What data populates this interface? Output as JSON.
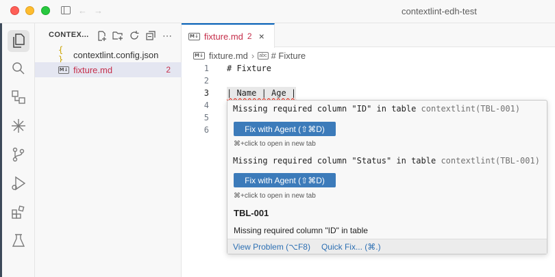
{
  "window": {
    "title": "contextlint-edh-test"
  },
  "sidebar": {
    "header": "CONTEX...",
    "files": [
      {
        "name": "contextlint.config.json",
        "type": "json",
        "icon": "{ }"
      },
      {
        "name": "fixture.md",
        "type": "markdown",
        "icon": "M↓",
        "errors": "2"
      }
    ]
  },
  "tab": {
    "name": "fixture.md",
    "count": "2",
    "icon": "M↓"
  },
  "breadcrumb": {
    "file": "fixture.md",
    "symbol": "# Fixture"
  },
  "editor": {
    "lines": [
      {
        "num": "1",
        "text": "# Fixture"
      },
      {
        "num": "2",
        "text": ""
      },
      {
        "num": "3",
        "text": "| Name | Age |"
      },
      {
        "num": "4",
        "text": ""
      },
      {
        "num": "5",
        "text": ""
      },
      {
        "num": "6",
        "text": ""
      }
    ]
  },
  "hover": {
    "problems": [
      {
        "message": "Missing required column \"ID\" in table",
        "source": "contextlint(TBL-001)",
        "button": "Fix with Agent (⇧⌘D)",
        "hint": "⌘+click to open in new tab"
      },
      {
        "message": "Missing required column \"Status\" in table",
        "source": "contextlint(TBL-001)",
        "button": "Fix with Agent (⇧⌘D)",
        "hint": "⌘+click to open in new tab"
      }
    ],
    "rule_code": "TBL-001",
    "rule_message": "Missing required column \"ID\" in table",
    "footer": {
      "view_problem": "View Problem (⌥F8)",
      "quick_fix": "Quick Fix... (⌘.)"
    }
  },
  "colors": {
    "accent": "#005fb8",
    "error": "#c52e4a",
    "button": "#3c7bba"
  }
}
